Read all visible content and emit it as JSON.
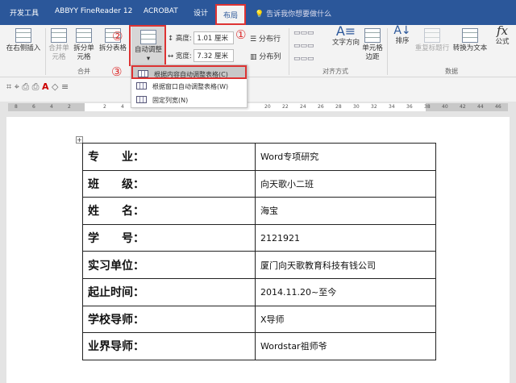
{
  "tabs": [
    "开发工具",
    "ABBYY FineReader 12",
    "ACROBAT",
    "设计",
    "布局"
  ],
  "search": "告诉我你想要做什么",
  "ribbon": {
    "insert_right": "在右侧插入",
    "merge_cells": "合并单元格",
    "split_cells": "拆分单元格",
    "split_table": "拆分表格",
    "merge_group": "合并",
    "autofit": "自动调整",
    "height_label": "高度:",
    "height_value": "1.01 厘米",
    "width_label": "宽度:",
    "width_value": "7.32 厘米",
    "dist_rows": "分布行",
    "dist_cols": "分布列",
    "text_dir": "文字方向",
    "cell_margin": "单元格边距",
    "align_group": "对齐方式",
    "sort": "排序",
    "repeat_header": "重复标题行",
    "convert_text": "转换为文本",
    "formula": "公式",
    "data_group": "数据"
  },
  "callouts": [
    "①",
    "②",
    "③"
  ],
  "menu": [
    {
      "label": "根据内容自动调整表格(C)",
      "selected": true
    },
    {
      "label": "根据窗口自动调整表格(W)",
      "selected": false
    },
    {
      "label": "固定列宽(N)",
      "selected": false
    }
  ],
  "ruler": [
    "8",
    "6",
    "4",
    "2",
    "2",
    "4",
    "20",
    "22",
    "24",
    "26",
    "28",
    "30",
    "32",
    "34",
    "36",
    "38",
    "40",
    "42",
    "44",
    "46"
  ],
  "table": [
    {
      "k": "专　　业：",
      "v": "Word专项研究"
    },
    {
      "k": "班　　级：",
      "v": "向天歌小二班"
    },
    {
      "k": "姓　　名：",
      "v": "海宝"
    },
    {
      "k": "学　　号：",
      "v": "2121921"
    },
    {
      "k": "实习单位：",
      "v": "厦门向天歌教育科技有钱公司"
    },
    {
      "k": "起止时间：",
      "v": "2014.11.20~至今"
    },
    {
      "k": "学校导师：",
      "v": "X导师"
    },
    {
      "k": "业界导师：",
      "v": "Wordstar祖师爷"
    }
  ],
  "colors": {
    "titlebar": "#2b579a",
    "highlight": "#dd3333"
  }
}
